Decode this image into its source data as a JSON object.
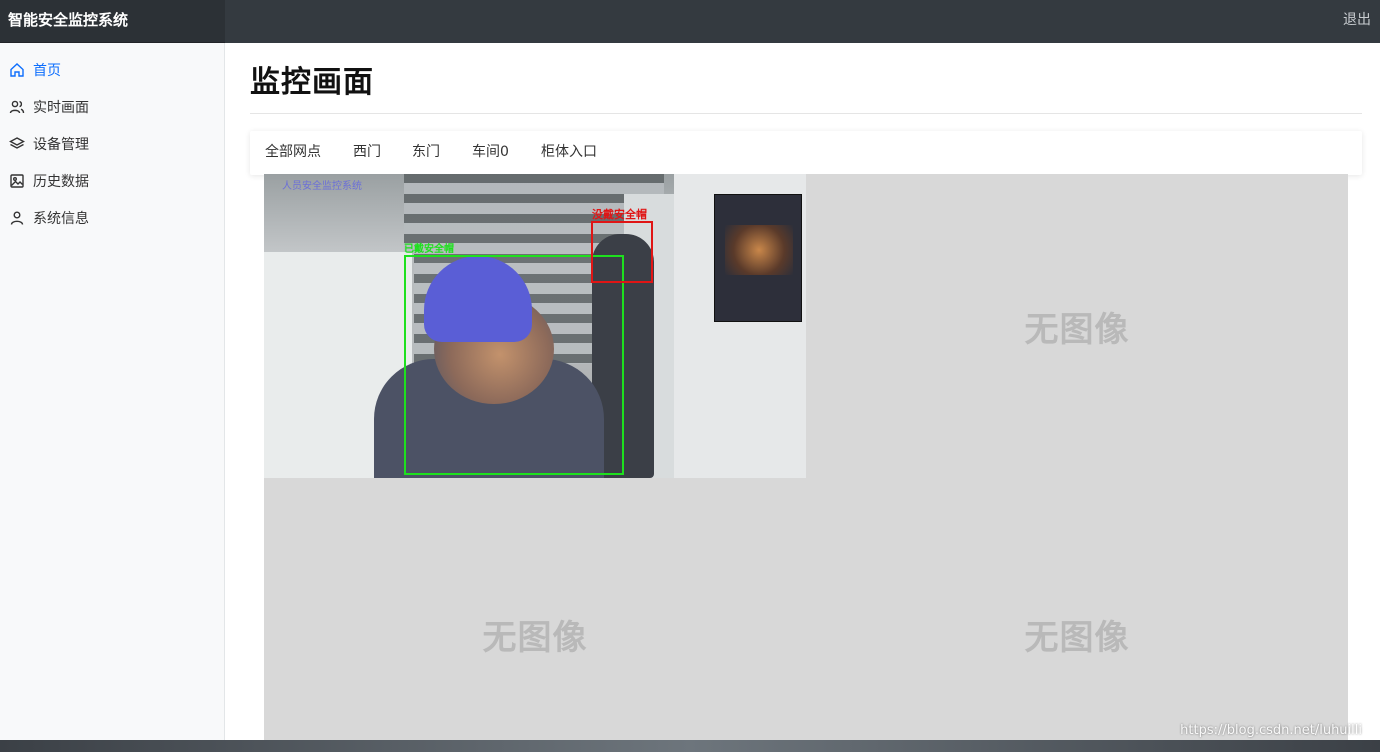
{
  "app": {
    "title": "智能安全监控系统",
    "logout_label": "退出"
  },
  "sidebar": {
    "items": [
      {
        "label": "首页",
        "icon": "home-icon",
        "active": true
      },
      {
        "label": "实时画面",
        "icon": "users-icon",
        "active": false
      },
      {
        "label": "设备管理",
        "icon": "layers-icon",
        "active": false
      },
      {
        "label": "历史数据",
        "icon": "image-icon",
        "active": false
      },
      {
        "label": "系统信息",
        "icon": "user-icon",
        "active": false
      }
    ]
  },
  "main": {
    "page_title": "监控画面",
    "tabs": [
      "全部网点",
      "西门",
      "东门",
      "车间0",
      "柜体入口"
    ],
    "feed": {
      "overlay_title": "人员安全监控系统",
      "green_label": "已戴安全帽",
      "red_label": "没戴安全帽"
    },
    "no_image_label": "无图像"
  },
  "watermark": "https://blog.csdn.net/luhuilli",
  "colors": {
    "accent": "#0d6efd",
    "topbar": "#343a40",
    "detect_ok": "#1ee01e",
    "detect_bad": "#e01515"
  }
}
